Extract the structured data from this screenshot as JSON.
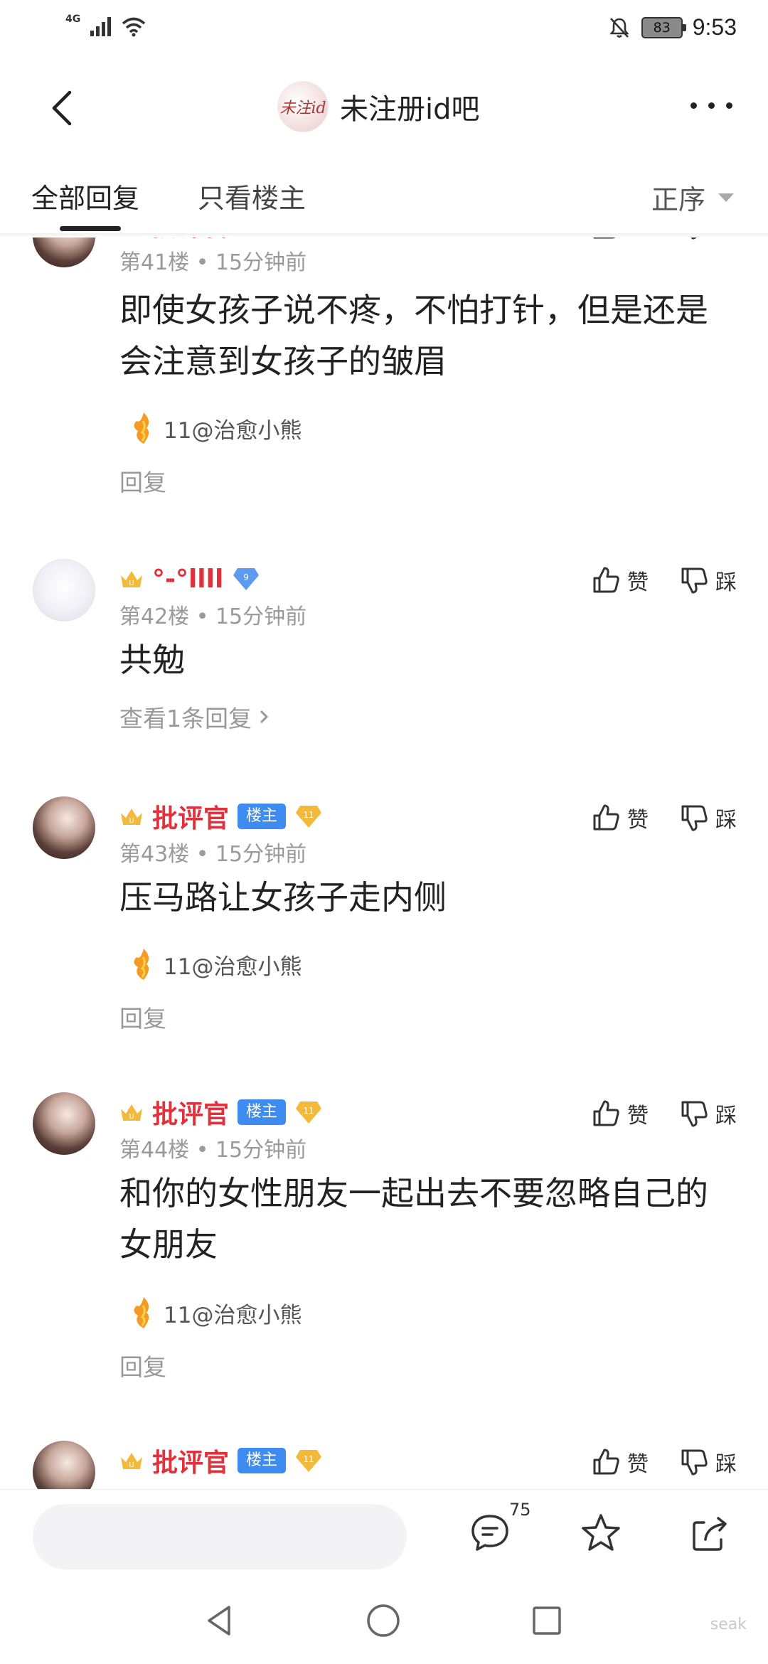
{
  "status_bar": {
    "network": "4G",
    "battery": "83",
    "time": "9:53"
  },
  "header": {
    "forum_avatar_text": "未注id",
    "forum_name": "未注册id吧"
  },
  "tabs": {
    "all_replies": "全部回复",
    "only_owner": "只看楼主",
    "sort_label": "正序"
  },
  "posts": [
    {
      "floor": "第41楼",
      "time": "15分钟前",
      "username": "批评官",
      "content": "即使女孩子说不疼，不怕打针，但是还是会注意到女孩子的皱眉",
      "signature": "11@治愈小熊",
      "reply_label": "回复",
      "like_label": "赞",
      "dislike_label": "踩"
    },
    {
      "floor": "第42楼",
      "time": "15分钟前",
      "username": "°-°llll",
      "level": "9",
      "content": "共勉",
      "view_replies": "查看1条回复",
      "like_label": "赞",
      "dislike_label": "踩"
    },
    {
      "floor": "第43楼",
      "time": "15分钟前",
      "username": "批评官",
      "owner_badge": "楼主",
      "level": "11",
      "content": "压马路让女孩子走内侧",
      "signature": "11@治愈小熊",
      "reply_label": "回复",
      "like_label": "赞",
      "dislike_label": "踩"
    },
    {
      "floor": "第44楼",
      "time": "15分钟前",
      "username": "批评官",
      "owner_badge": "楼主",
      "level": "11",
      "content": "和你的女性朋友一起出去不要忽略自己的女朋友",
      "signature": "11@治愈小熊",
      "reply_label": "回复",
      "like_label": "赞",
      "dislike_label": "踩"
    },
    {
      "username": "批评官",
      "owner_badge": "楼主",
      "level": "11",
      "like_label": "赞",
      "dislike_label": "踩"
    }
  ],
  "bottom_bar": {
    "comment_count": "75"
  },
  "watermark": "seak",
  "colors": {
    "username_red": "#e0323c",
    "owner_badge_blue": "#3f8cf0",
    "level_gold": "#f2b93b",
    "level_blue": "#5b9cf2"
  }
}
